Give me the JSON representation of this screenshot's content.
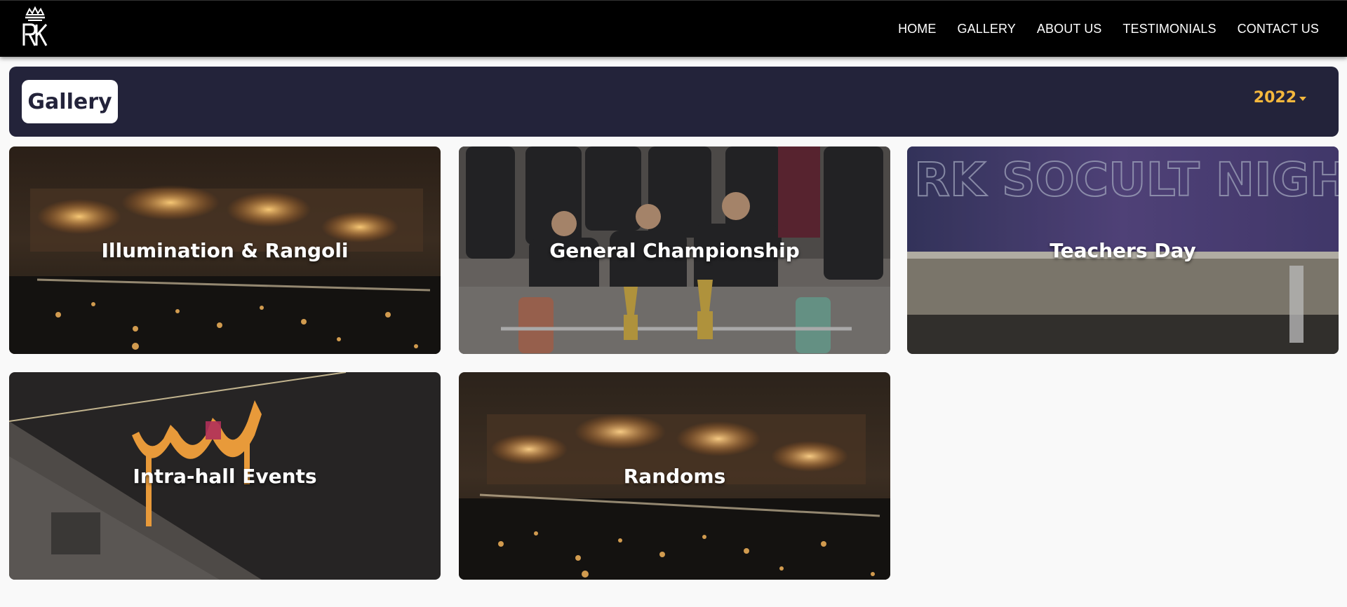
{
  "navbar": {
    "logo_alt": "RK",
    "links": [
      "HOME",
      "GALLERY",
      "ABOUT US",
      "TESTIMONIALS",
      "CONTACT US"
    ]
  },
  "gallery": {
    "title": "Gallery",
    "year": "2022"
  },
  "cards": [
    {
      "label": "Illumination & Rangoli"
    },
    {
      "label": "General Championship"
    },
    {
      "label": "Teachers Day"
    },
    {
      "label": "Intra-hall Events"
    },
    {
      "label": "Randoms"
    }
  ],
  "theme": {
    "nav_bg": "#000000",
    "header_bg": "#23233a",
    "accent": "#f5b83d",
    "page_bg": "#f9f9f9"
  }
}
